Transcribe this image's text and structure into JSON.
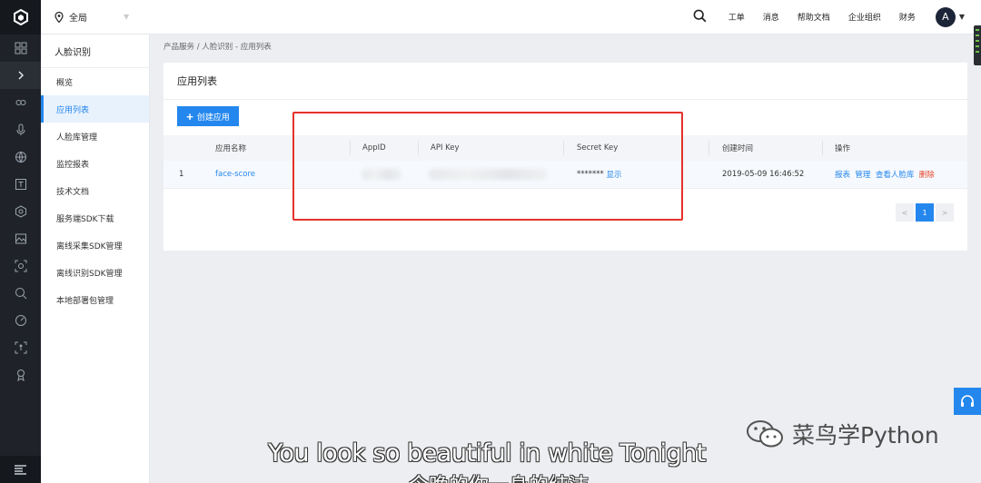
{
  "topbar": {
    "region": "全局",
    "links": [
      "工单",
      "消息",
      "帮助文档",
      "企业组织",
      "财务"
    ],
    "avatar_letter": "A"
  },
  "sidebar": {
    "title": "人脸识别",
    "items": [
      {
        "label": "概览",
        "active": false
      },
      {
        "label": "应用列表",
        "active": true
      },
      {
        "label": "人脸库管理",
        "active": false
      },
      {
        "label": "监控报表",
        "active": false
      },
      {
        "label": "技术文档",
        "active": false
      },
      {
        "label": "服务端SDK下载",
        "active": false
      },
      {
        "label": "离线采集SDK管理",
        "active": false
      },
      {
        "label": "离线识别SDK管理",
        "active": false
      },
      {
        "label": "本地部署包管理",
        "active": false
      }
    ]
  },
  "breadcrumb": "产品服务 / 人脸识别 - 应用列表",
  "panel": {
    "title": "应用列表",
    "create_label": "创建应用"
  },
  "table": {
    "columns": [
      "应用名称",
      "AppID",
      "API Key",
      "Secret Key",
      "创建时间",
      "操作"
    ],
    "rows": [
      {
        "index": "1",
        "name": "face-score",
        "secret_mask": "*******",
        "secret_show": "显示",
        "created": "2019-05-09 16:46:52",
        "actions": [
          "报表",
          "管理",
          "查看人脸库",
          "删除"
        ]
      }
    ]
  },
  "pager": {
    "prev": "<",
    "current": "1",
    "next": ">"
  },
  "overlay": {
    "watermark": "菜鸟学Python",
    "subtitle": "You look so beautiful in white Tonight",
    "subtitle_cn": "今晚的你一身的纯洁"
  },
  "colors": {
    "accent": "#2487ee",
    "danger": "#e8452c",
    "highlight_box": "#e4322b",
    "rail": "#1f2329"
  }
}
